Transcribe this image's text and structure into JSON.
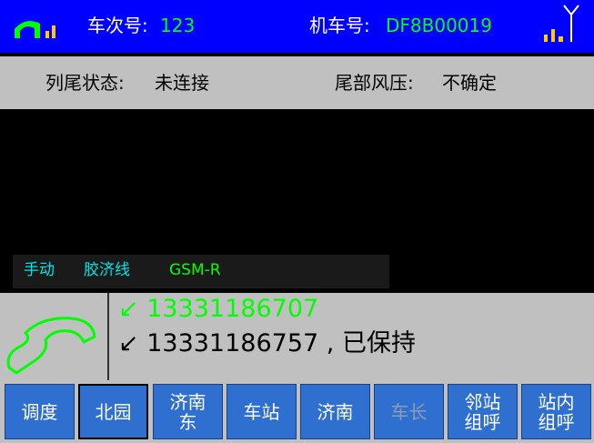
{
  "header": {
    "train_no_label": "车次号:",
    "train_no_value": "123",
    "loco_no_label": "机车号:",
    "loco_no_value": "DF8B00019"
  },
  "status": {
    "tail_state_label": "列尾状态:",
    "tail_state_value": "未连接",
    "tail_pressure_label": "尾部风压:",
    "tail_pressure_value": "不确定"
  },
  "mode": {
    "mode": "手动",
    "line": "胶济线",
    "network": "GSM-R"
  },
  "calls": [
    {
      "symbol": "↙",
      "number": "13331186707",
      "status": ""
    },
    {
      "symbol": "↙",
      "number": "13331186757",
      "status": ", 已保持"
    }
  ],
  "buttons": [
    {
      "label": "调度"
    },
    {
      "label": "北园"
    },
    {
      "label": "济南\n东"
    },
    {
      "label": "车站"
    },
    {
      "label": "济南"
    },
    {
      "label": "车长"
    },
    {
      "label": "邻站\n组呼"
    },
    {
      "label": "站内\n组呼"
    }
  ],
  "colors": {
    "header_bg": "#0000ff",
    "panel_bg": "#c0c0c0",
    "value_green": "#00ff00",
    "alert_red": "#ff0000",
    "button_blue": "#2f6fd0"
  }
}
